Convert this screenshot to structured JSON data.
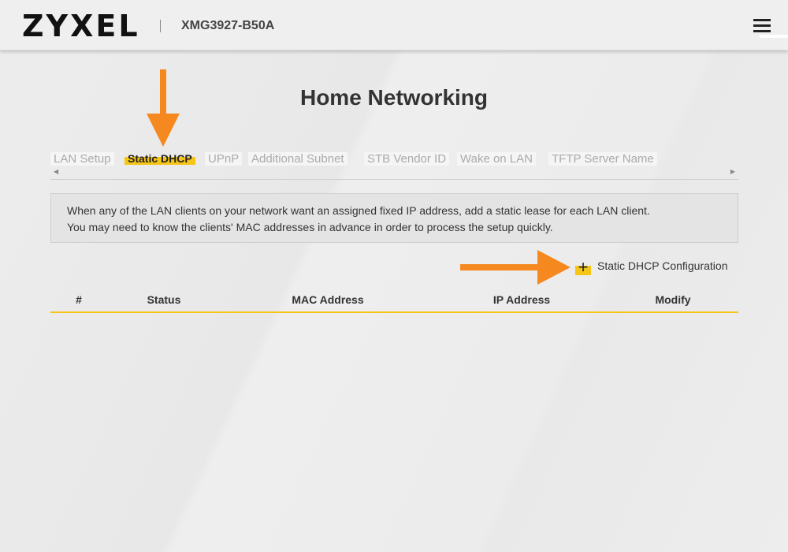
{
  "header": {
    "logo_text": "ZYXEL",
    "model": "XMG3927-B50A",
    "menu_icon": "hamburger-menu-icon"
  },
  "page": {
    "title": "Home Networking"
  },
  "tabs": [
    {
      "label": "LAN Setup",
      "active": false
    },
    {
      "label": "Static DHCP",
      "active": true
    },
    {
      "label": "UPnP",
      "active": false
    },
    {
      "label": "Additional Subnet",
      "active": false
    },
    {
      "label": "STB Vendor ID",
      "active": false
    },
    {
      "label": "Wake on LAN",
      "active": false
    },
    {
      "label": "TFTP Server Name",
      "active": false
    }
  ],
  "info": {
    "line1": "When any of the LAN clients on your network want an assigned fixed IP address, add a static lease for each LAN client.",
    "line2": "You may need to know the clients' MAC addresses in advance in order to process the setup quickly."
  },
  "actions": {
    "add_label": "Static DHCP Configuration",
    "add_icon": "plus-icon"
  },
  "table": {
    "columns": [
      "#",
      "Status",
      "MAC Address",
      "IP Address",
      "Modify"
    ],
    "rows": []
  },
  "colors": {
    "accent": "#f5c518",
    "annotation_arrow": "#f5891f"
  }
}
